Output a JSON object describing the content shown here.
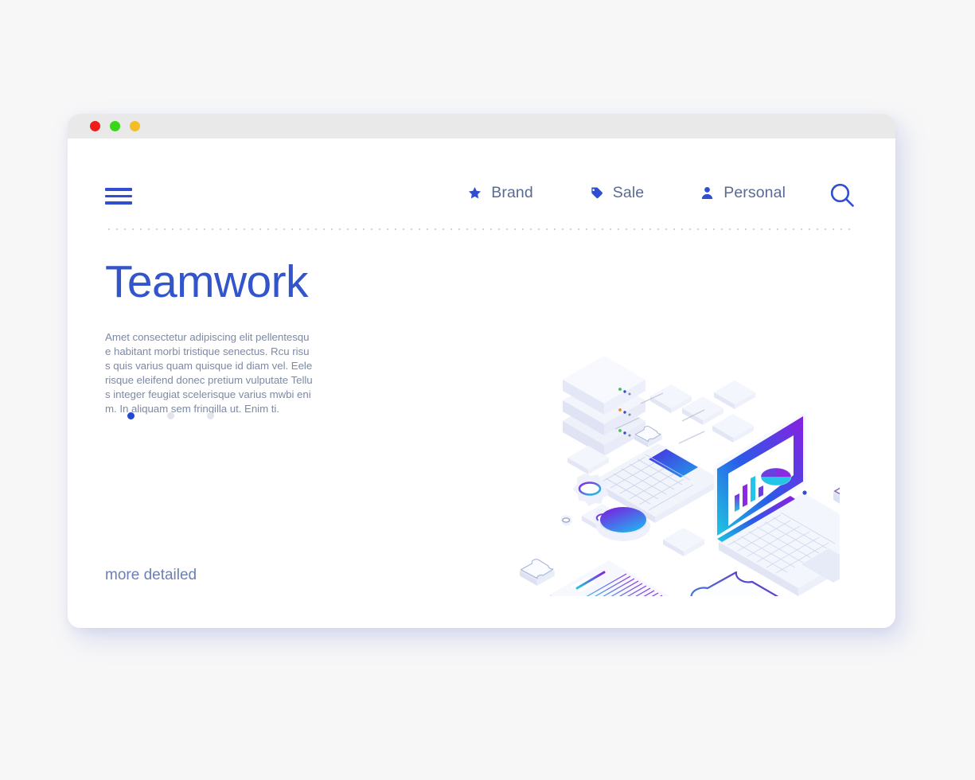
{
  "window": {
    "traffic_lights": [
      {
        "name": "close",
        "color": "#f01b1b"
      },
      {
        "name": "minimize",
        "color": "#37d619"
      },
      {
        "name": "maximize",
        "color": "#f4bd24"
      }
    ]
  },
  "nav": {
    "menu_icon": "hamburger-icon",
    "search_icon": "search-icon",
    "items": [
      {
        "label": "Brand",
        "icon": "star-icon"
      },
      {
        "label": "Sale",
        "icon": "tag-icon"
      },
      {
        "label": "Personal",
        "icon": "person-icon"
      }
    ]
  },
  "hero": {
    "title": "Teamwork",
    "paragraph": "Amet consectetur adipiscing elit pellentesque habitant morbi tristique senectus. Rcu risus quis varius quam quisque id diam vel. Eelerisque eleifend donec pretium vulputate Tellus integer feugiat scelerisque varius mwbi enim. In aliquam sem fringilla ut. Enim ti.",
    "more_link": "more detailed",
    "pagination": [
      {
        "index": 1,
        "active": true
      },
      {
        "index": 2,
        "active": false
      },
      {
        "index": 3,
        "active": false
      }
    ]
  },
  "colors": {
    "accent_blue": "#3355cc",
    "nav_text": "#5a6a93",
    "body_text": "#7c8aa8",
    "page_background": "#f7f7f8",
    "titlebar": "#e9e9ea",
    "gradient_start": "#8a1fe0",
    "gradient_end": "#1fc8e0"
  },
  "illustration": {
    "name": "isometric-teamwork-illustration",
    "elements": [
      "server-stack",
      "keyboard",
      "laptop-with-charts",
      "puzzle-piece-large",
      "puzzle-piece-small",
      "gear",
      "clipboard-document",
      "cylinder",
      "cards"
    ]
  }
}
